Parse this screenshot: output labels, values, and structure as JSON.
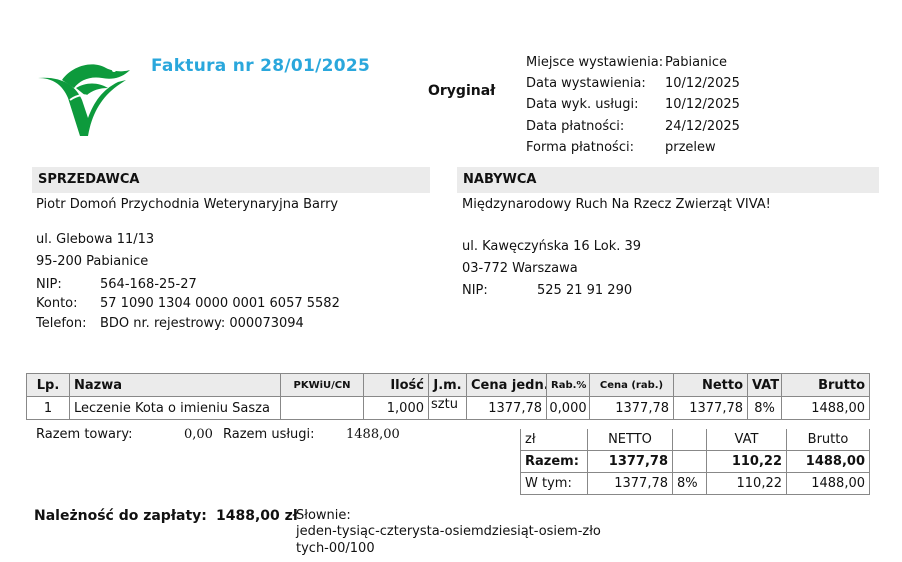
{
  "invoice": {
    "title": "Faktura nr 28/01/2025",
    "copy_label": "Oryginał"
  },
  "meta": [
    {
      "label": "Miejsce wystawienia:",
      "value": "Pabianice"
    },
    {
      "label": "Data wystawienia:",
      "value": "10/12/2025"
    },
    {
      "label": "Data wyk. usługi:",
      "value": "10/12/2025"
    },
    {
      "label": "Data płatności:",
      "value": "24/12/2025"
    },
    {
      "label": "Forma płatności:",
      "value": "przelew"
    }
  ],
  "seller": {
    "header": "SPRZEDAWCA",
    "name": "Piotr Domoń Przychodnia Weterynaryjna Barry",
    "street": "ul. Glebowa 11/13",
    "city": "95-200 Pabianice",
    "nip_label": "NIP:",
    "nip": "564-168-25-27",
    "account_label": "Konto:",
    "account": "57 1090 1304 0000 0001 6057 5582",
    "phone_label": "Telefon:",
    "phone": "BDO nr. rejestrowy: 000073094"
  },
  "buyer": {
    "header": "NABYWCA",
    "name": "Międzynarodowy Ruch Na Rzecz Zwierząt VIVA!",
    "street": "ul. Kawęczyńska 16 Lok. 39",
    "city": "03-772 Warszawa",
    "nip_label": "NIP:",
    "nip": "525 21 91 290"
  },
  "items_table": {
    "headers": [
      "Lp.",
      "Nazwa",
      "PKWiU/CN",
      "Ilość",
      "J.m.",
      "Cena jedn.",
      "Rab.%",
      "Cena (rab.)",
      "Netto",
      "VAT",
      "Brutto"
    ],
    "rows": [
      [
        "1",
        "Leczenie Kota o imieniu Sasza",
        "",
        "1,000",
        "sztu",
        "1377,78",
        "0,000",
        "1377,78",
        "1377,78",
        "8%",
        "1488,00"
      ]
    ]
  },
  "totals_line": {
    "goods_label": "Razem towary:",
    "goods_value": "0,00",
    "services_label": "Razem usługi:",
    "services_value": "1488,00"
  },
  "summary": {
    "currency": "zł",
    "netto_label": "NETTO",
    "vat_label": "VAT",
    "brutto_label": "Brutto",
    "total_label": "Razem:",
    "total_netto": "1377,78",
    "total_vat": "110,22",
    "total_brutto": "1488,00",
    "of_which_label": "W tym:",
    "rate_netto": "1377,78",
    "rate": "8%",
    "rate_vat": "110,22",
    "rate_brutto": "1488,00"
  },
  "payment": {
    "due_label": "Należność do zapłaty:",
    "due_amount": "1488,00 zł",
    "words_label": "Słownie:",
    "words_line1": "jeden-tysiąc-czterysta-osiemdziesiąt-osiem-zło",
    "words_line2": "tych-00/100"
  },
  "colors": {
    "title": "#2aa7dc",
    "logo_green": "#0d9a3c",
    "header_bg": "#ebebeb"
  }
}
